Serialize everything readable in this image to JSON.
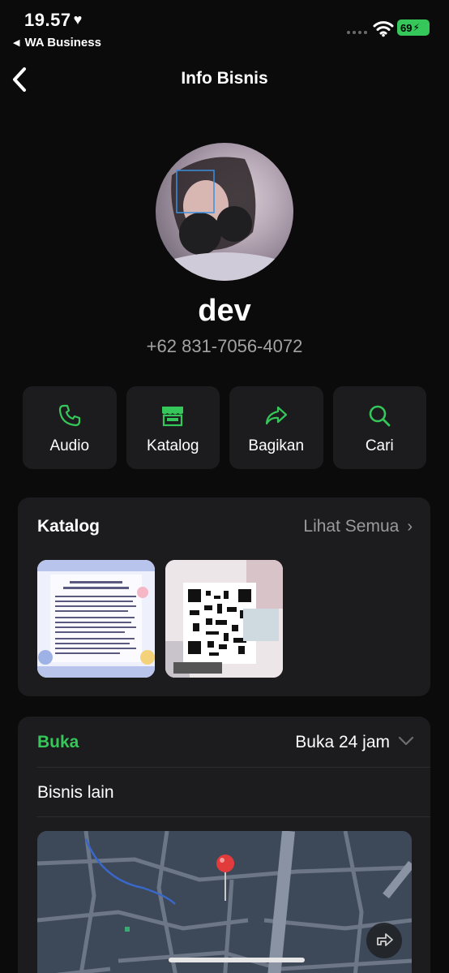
{
  "status_bar": {
    "time": "19.57",
    "back_app": "WA Business",
    "battery": "69"
  },
  "nav": {
    "title": "Info Bisnis"
  },
  "profile": {
    "name": "dev",
    "phone": "+62 831-7056-4072"
  },
  "actions": [
    {
      "label": "Audio",
      "icon": "phone-icon"
    },
    {
      "label": "Katalog",
      "icon": "store-icon"
    },
    {
      "label": "Bagikan",
      "icon": "share-icon"
    },
    {
      "label": "Cari",
      "icon": "search-icon"
    }
  ],
  "catalog": {
    "title": "Katalog",
    "see_all": "Lihat Semua"
  },
  "hours": {
    "status": "Buka",
    "value": "Buka 24 jam",
    "other": "Bisnis lain"
  },
  "colors": {
    "accent": "#35c759",
    "background": "#0b0b0b",
    "card": "#1c1c1e"
  }
}
